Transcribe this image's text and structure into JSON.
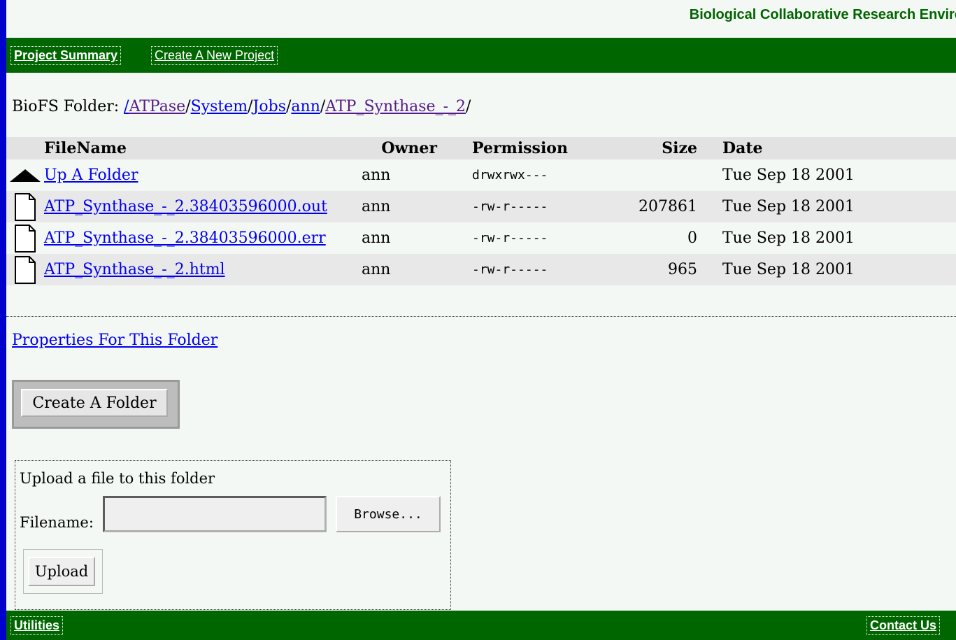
{
  "site_title": "Biological Collaborative Research Environment",
  "topnav": {
    "project_summary": "Project Summary",
    "create_project": "Create A New Project"
  },
  "breadcrumb": {
    "prefix": "BioFS Folder: ",
    "root": "/",
    "parts": [
      "ATPase",
      "System",
      "Jobs",
      "ann",
      "ATP_Synthase_-_2"
    ],
    "sep": "/"
  },
  "table": {
    "headers": {
      "filename": "FileName",
      "owner": "Owner",
      "permission": "Permission",
      "size": "Size",
      "date": "Date"
    },
    "rows": [
      {
        "name": "Up A Folder",
        "owner": "ann",
        "permission": "drwxrwx---",
        "size": "",
        "date": "Tue Sep 18 2001",
        "icon": "up-arrow-icon"
      },
      {
        "name": "ATP_Synthase_-_2.38403596000.out",
        "owner": "ann",
        "permission": "-rw-r-----",
        "size": "207861",
        "date": "Tue Sep 18 2001",
        "icon": "document-icon"
      },
      {
        "name": "ATP_Synthase_-_2.38403596000.err",
        "owner": "ann",
        "permission": "-rw-r-----",
        "size": "0",
        "date": "Tue Sep 18 2001",
        "icon": "document-icon"
      },
      {
        "name": "ATP_Synthase_-_2.html",
        "owner": "ann",
        "permission": "-rw-r-----",
        "size": "965",
        "date": "Tue Sep 18 2001",
        "icon": "document-icon"
      }
    ]
  },
  "properties_link": "Properties For This Folder",
  "create_folder_label": "Create A Folder",
  "upload": {
    "title": "Upload a file to this folder",
    "filename_label": "Filename:",
    "filename_value": "",
    "browse_label": "Browse...",
    "upload_label": "Upload"
  },
  "botnav": {
    "utilities": "Utilities",
    "contact": "Contact Us"
  },
  "colors": {
    "nav_green": "#006600",
    "title_green": "#006400",
    "frame_blue": "#0000cc",
    "link": "#0000ee",
    "visited": "#551a8b"
  }
}
